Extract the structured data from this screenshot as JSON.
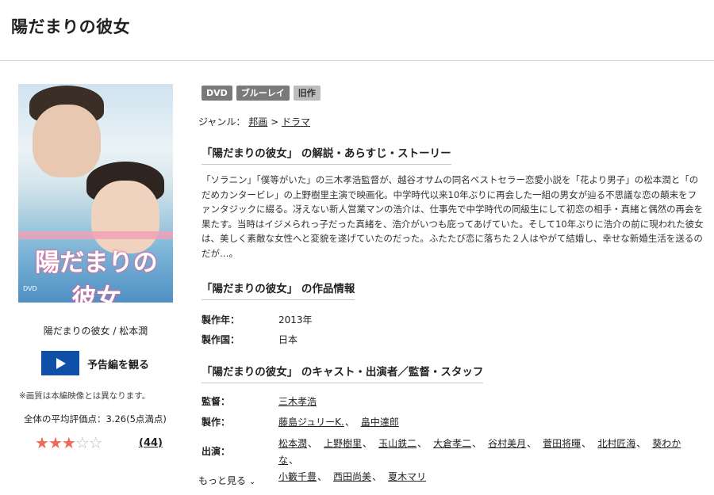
{
  "page": {
    "title": "陽だまりの彼女"
  },
  "poster": {
    "title_text": "陽だまりの彼女",
    "caption": "陽だまりの彼女 / 松本潤"
  },
  "trailer": {
    "label": "予告編を観る"
  },
  "note": "※画質は本編映像とは異なります。",
  "rating": {
    "text": "全体の平均評価点：3.26(5点満点)",
    "value": 3.26,
    "max": 5,
    "review_count": "(44)"
  },
  "badges": [
    "DVD",
    "ブルーレイ",
    "旧作"
  ],
  "genre": {
    "label": "ジャンル：",
    "crumbs": [
      "邦画",
      "ドラマ"
    ],
    "separator": ">"
  },
  "sections": {
    "synopsis_heading": "「陽だまりの彼女」 の解説・あらすじ・ストーリー",
    "synopsis": "「ソラニン」「僕等がいた」の三木孝浩監督が、越谷オサムの同名ベストセラー恋愛小説を「花より男子」の松本潤と「のだめカンタービレ」の上野樹里主演で映画化。中学時代以来10年ぶりに再会した一組の男女が辿る不思議な恋の顛末をファンタジックに綴る。冴えない新人営業マンの浩介は、仕事先で中学時代の同級生にして初恋の相手・真緒と偶然の再会を果たす。当時はイジメられっ子だった真緒を、浩介がいつも庇ってあげていた。そして10年ぶりに浩介の前に現われた彼女は、美しく素敵な女性へと変貌を遂げていたのだった。ふたたび恋に落ちた２人はやがて結婚し、幸せな新婚生活を送るのだが…。",
    "info_heading": "「陽だまりの彼女」 の作品情報",
    "cast_heading": "「陽だまりの彼女」 のキャスト・出演者／監督・スタッフ"
  },
  "info": {
    "year_label": "製作年：",
    "year": "2013年",
    "country_label": "製作国：",
    "country": "日本"
  },
  "staff": {
    "director_label": "監督：",
    "director": "三木孝浩",
    "producer_label": "製作：",
    "producers": [
      "藤島ジュリーK.",
      "畠中達郎"
    ],
    "cast_label": "出演：",
    "cast": [
      "松本潤",
      "上野樹里",
      "玉山鉄二",
      "大倉孝二",
      "谷村美月",
      "菅田将暉",
      "北村匠海",
      "葵わかな",
      "小籔千豊",
      "西田尚美",
      "夏木マリ"
    ]
  },
  "more": "もっと見る"
}
